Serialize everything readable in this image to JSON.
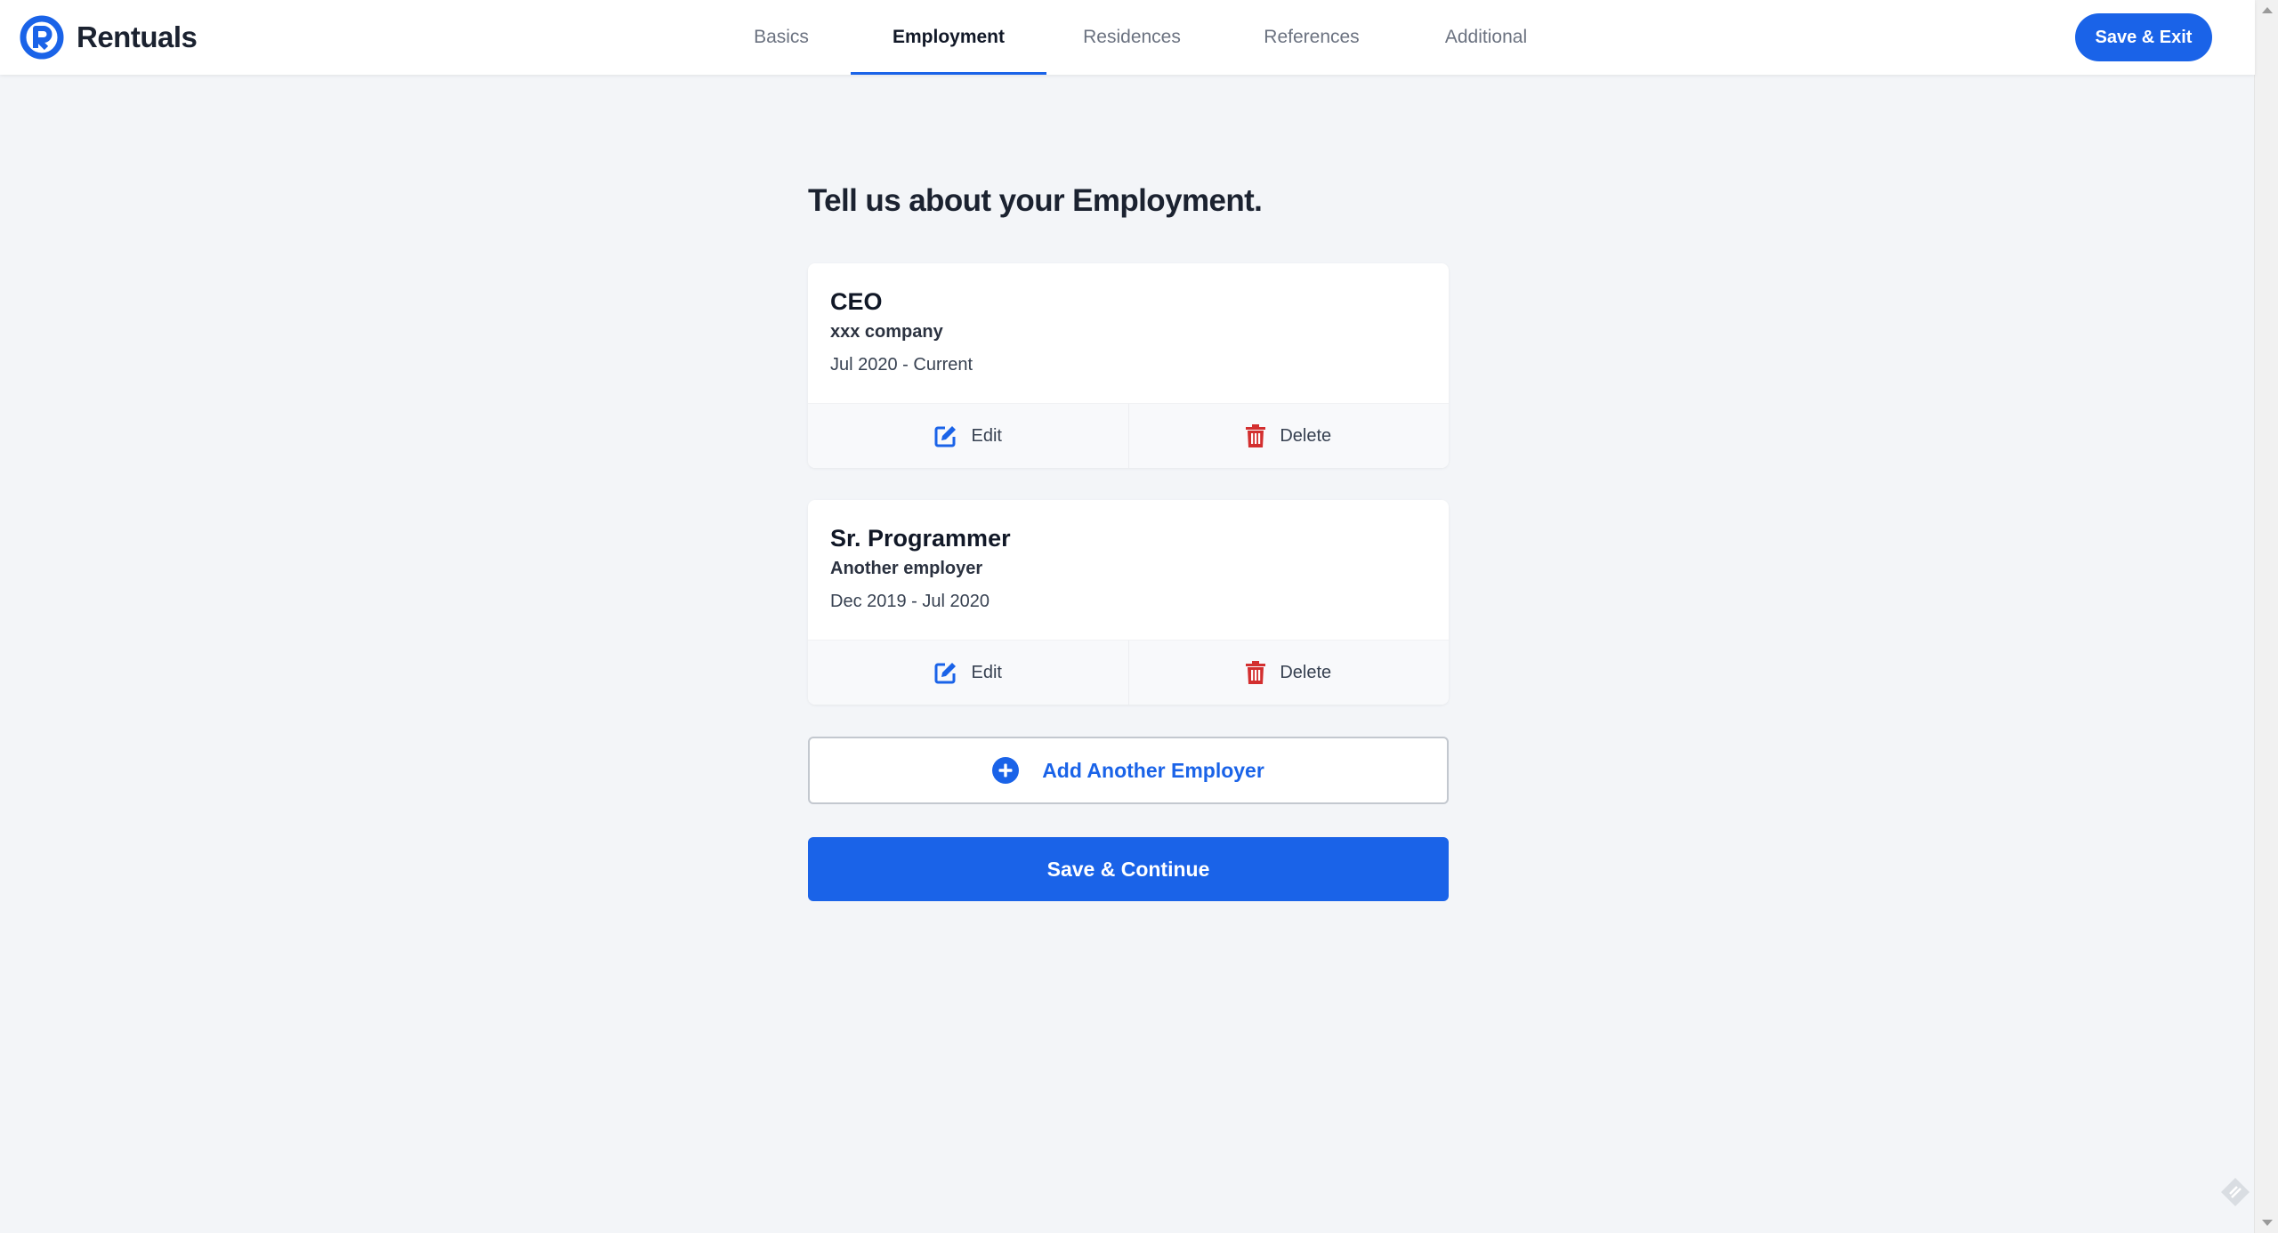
{
  "app": {
    "name": "Rentuals",
    "accent": "#1a63e8",
    "danger": "#d32f2f"
  },
  "nav": {
    "tabs": [
      {
        "label": "Basics",
        "active": false
      },
      {
        "label": "Employment",
        "active": true
      },
      {
        "label": "Residences",
        "active": false
      },
      {
        "label": "References",
        "active": false
      },
      {
        "label": "Additional",
        "active": false
      }
    ],
    "save_exit_label": "Save & Exit"
  },
  "page": {
    "heading": "Tell us about your Employment."
  },
  "employers": [
    {
      "title": "CEO",
      "company": "xxx company",
      "dates": "Jul 2020 - Current",
      "edit_label": "Edit",
      "delete_label": "Delete"
    },
    {
      "title": "Sr. Programmer",
      "company": "Another employer",
      "dates": "Dec 2019 - Jul 2020",
      "edit_label": "Edit",
      "delete_label": "Delete"
    }
  ],
  "actions": {
    "add_employer_label": "Add Another Employer",
    "save_continue_label": "Save & Continue"
  },
  "icons": {
    "logo": "rentuals-logo-icon",
    "edit": "edit-icon",
    "delete": "trash-icon",
    "add": "plus-circle-icon",
    "corner": "feedback-icon"
  }
}
